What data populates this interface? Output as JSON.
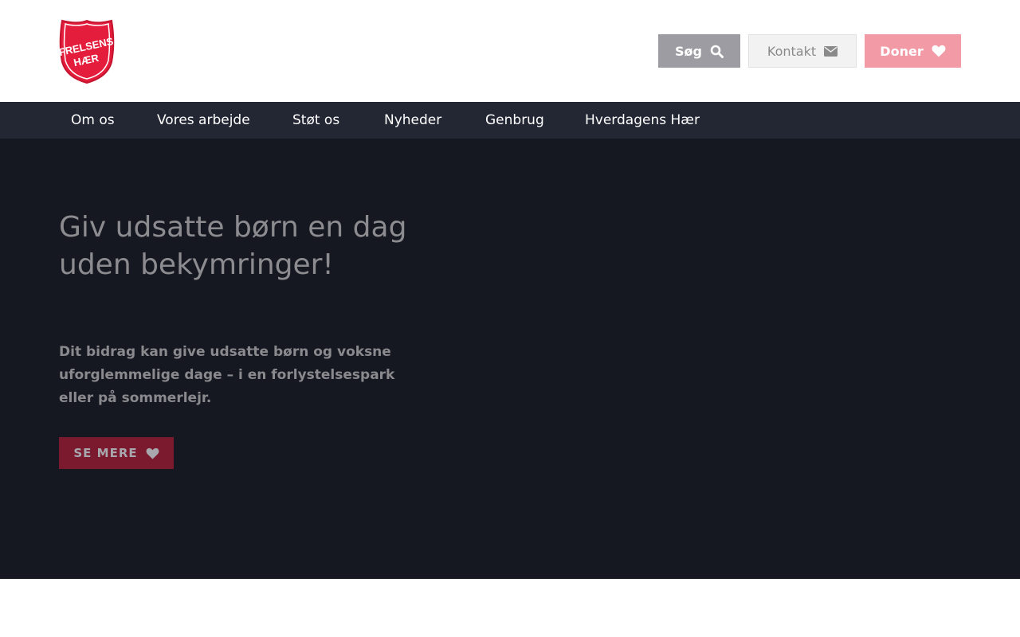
{
  "logo": {
    "line1": "FRELSENS",
    "line2": "HÆR",
    "icon": "shield-logo",
    "color": "#e41d3c"
  },
  "header": {
    "search_label": "Søg",
    "contact_label": "Kontakt",
    "donate_label": "Doner",
    "search_icon": "search-icon",
    "contact_icon": "envelope-icon",
    "donate_icon": "heart-icon"
  },
  "nav": {
    "items": [
      {
        "label": "Om os"
      },
      {
        "label": "Vores arbejde"
      },
      {
        "label": "Støt os"
      },
      {
        "label": "Nyheder"
      },
      {
        "label": "Genbrug"
      },
      {
        "label": "Hverdagens Hær"
      }
    ]
  },
  "hero": {
    "title": "Giv udsatte børn en dag uden bekymringer!",
    "text": "Dit bidrag kan give udsatte børn og voksne uforglemmelige dage – i en forlystelsespark eller på sommerlejr.",
    "cta_label": "SE MERE",
    "cta_icon": "heart-icon"
  },
  "colors": {
    "nav_bg": "#232733",
    "hero_bg": "#161821",
    "accent": "#e41d3c"
  }
}
